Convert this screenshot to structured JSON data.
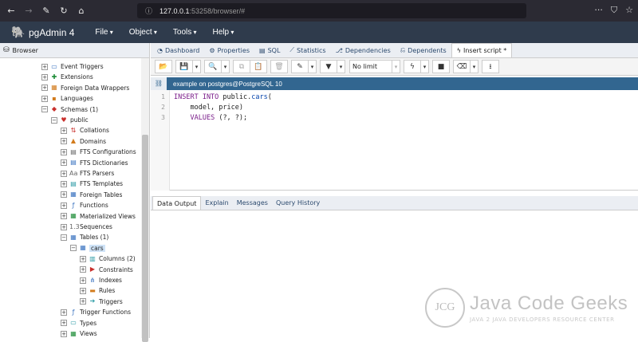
{
  "browser": {
    "url_main": "127.0.0.1",
    "url_rest": ":53258/browser/#"
  },
  "app": {
    "title": "pgAdmin 4",
    "menu": [
      "File",
      "Object",
      "Tools",
      "Help"
    ]
  },
  "left_panel": {
    "tab_label": "Browser",
    "tree": [
      {
        "label": "Event Triggers",
        "toggle": "+",
        "icon": "event-trigger-icon"
      },
      {
        "label": "Extensions",
        "toggle": "+",
        "icon": "extension-icon"
      },
      {
        "label": "Foreign Data Wrappers",
        "toggle": "+",
        "icon": "fdw-icon"
      },
      {
        "label": "Languages",
        "toggle": "+",
        "icon": "language-icon"
      },
      {
        "label": "Schemas (1)",
        "toggle": "−",
        "icon": "schemas-icon"
      },
      {
        "label": "public",
        "toggle": "−",
        "icon": "schema-icon"
      },
      {
        "label": "Collations",
        "toggle": "+",
        "icon": "collation-icon"
      },
      {
        "label": "Domains",
        "toggle": "+",
        "icon": "domain-icon"
      },
      {
        "label": "FTS Configurations",
        "toggle": "+",
        "icon": "fts-config-icon"
      },
      {
        "label": "FTS Dictionaries",
        "toggle": "+",
        "icon": "fts-dict-icon"
      },
      {
        "label": "FTS Parsers",
        "toggle": "+",
        "icon": "fts-parser-icon"
      },
      {
        "label": "FTS Templates",
        "toggle": "+",
        "icon": "fts-template-icon"
      },
      {
        "label": "Foreign Tables",
        "toggle": "+",
        "icon": "foreign-table-icon"
      },
      {
        "label": "Functions",
        "toggle": "+",
        "icon": "function-icon"
      },
      {
        "label": "Materialized Views",
        "toggle": "+",
        "icon": "matview-icon"
      },
      {
        "label": "Sequences",
        "toggle": "+",
        "icon": "sequence-icon"
      },
      {
        "label": "Tables (1)",
        "toggle": "−",
        "icon": "tables-icon"
      },
      {
        "label": "cars",
        "toggle": "−",
        "icon": "table-icon"
      },
      {
        "label": "Columns (2)",
        "toggle": "+",
        "icon": "columns-icon"
      },
      {
        "label": "Constraints",
        "toggle": "+",
        "icon": "constraints-icon"
      },
      {
        "label": "Indexes",
        "toggle": "+",
        "icon": "indexes-icon"
      },
      {
        "label": "Rules",
        "toggle": "+",
        "icon": "rules-icon"
      },
      {
        "label": "Triggers",
        "toggle": "+",
        "icon": "triggers-icon"
      },
      {
        "label": "Trigger Functions",
        "toggle": "+",
        "icon": "trigger-function-icon"
      },
      {
        "label": "Types",
        "toggle": "+",
        "icon": "types-icon"
      },
      {
        "label": "Views",
        "toggle": "+",
        "icon": "views-icon"
      }
    ]
  },
  "tabs": [
    {
      "label": "Dashboard",
      "icon": "dashboard-icon"
    },
    {
      "label": "Properties",
      "icon": "properties-icon"
    },
    {
      "label": "SQL",
      "icon": "sql-icon"
    },
    {
      "label": "Statistics",
      "icon": "statistics-icon"
    },
    {
      "label": "Dependencies",
      "icon": "dependencies-icon"
    },
    {
      "label": "Dependents",
      "icon": "dependents-icon"
    },
    {
      "label": "Insert script *",
      "icon": "lightning-icon",
      "active": true
    }
  ],
  "toolbar": {
    "limit_label": "No limit"
  },
  "connection": {
    "label": "example on postgres@PostgreSQL 10"
  },
  "editor": {
    "line_numbers": [
      "1",
      "2",
      "3"
    ]
  },
  "result_tabs": [
    {
      "label": "Data Output",
      "active": true
    },
    {
      "label": "Explain"
    },
    {
      "label": "Messages"
    },
    {
      "label": "Query History"
    }
  ],
  "watermark": {
    "logo_text": "JCG",
    "title": "Java Code Geeks",
    "subtitle": "JAVA 2 JAVA DEVELOPERS RESOURCE CENTER"
  }
}
